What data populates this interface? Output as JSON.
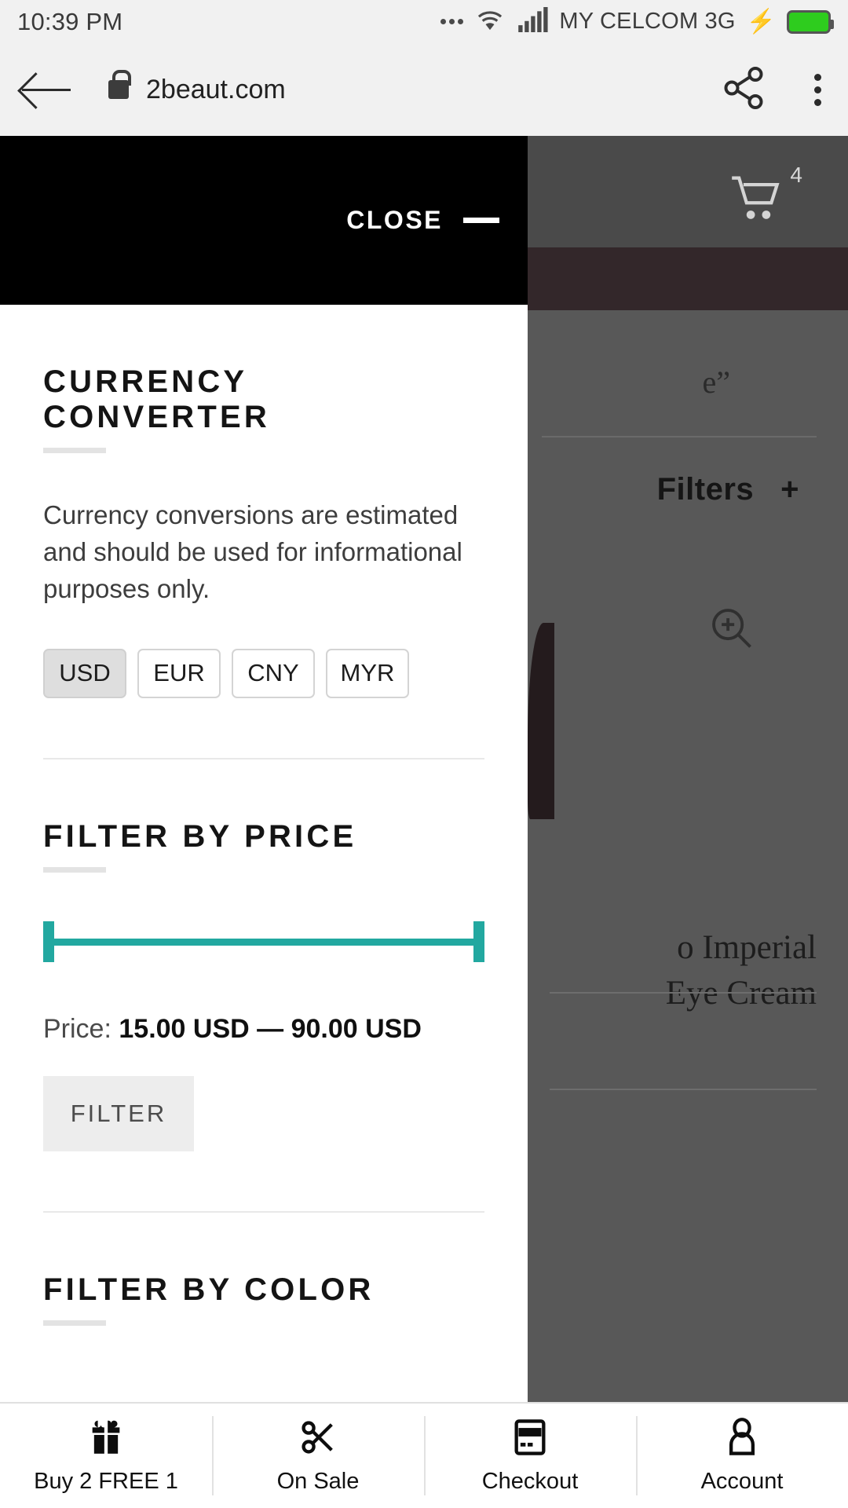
{
  "status_bar": {
    "time": "10:39 PM",
    "carrier": "MY CELCOM 3G",
    "icons": [
      "more-dots-icon",
      "wifi-icon",
      "signal-icon",
      "charging-bolt-icon",
      "battery-icon"
    ]
  },
  "browser_bar": {
    "url": "2beaut.com",
    "back_icon": "back-arrow-icon",
    "lock_icon": "lock-icon",
    "share_icon": "share-icon",
    "menu_icon": "kebab-menu-icon"
  },
  "drawer": {
    "close_label": "CLOSE",
    "currency_converter": {
      "title": "CURRENCY CONVERTER",
      "description": "Currency conversions are estimated and should be used for informational purposes only.",
      "currencies": [
        {
          "code": "USD",
          "selected": true
        },
        {
          "code": "EUR",
          "selected": false
        },
        {
          "code": "CNY",
          "selected": false
        },
        {
          "code": "MYR",
          "selected": false
        }
      ]
    },
    "filter_by_price": {
      "title": "FILTER BY PRICE",
      "price_prefix": "Price:",
      "price_range": "15.00 USD — 90.00 USD",
      "min_value": "15.00",
      "max_value": "90.00",
      "currency": "USD",
      "slider_color": "#22a8a0",
      "filter_button": "FILTER"
    },
    "filter_by_color": {
      "title": "FILTER BY COLOR"
    }
  },
  "background_page": {
    "cart_badge": "4",
    "cart_icon": "shopping-cart-icon",
    "filters_label": "Filters",
    "filters_plus": "+",
    "quote_fragment": "e”",
    "zoom_icon": "zoom-in-icon",
    "product_title_line1": "o Imperial",
    "product_title_line2": "Eye Cream"
  },
  "bottom_nav": [
    {
      "label": "Buy 2 FREE 1",
      "icon": "gift-icon"
    },
    {
      "label": "On Sale",
      "icon": "scissors-icon"
    },
    {
      "label": "Checkout",
      "icon": "credit-card-icon"
    },
    {
      "label": "Account",
      "icon": "person-icon"
    }
  ]
}
